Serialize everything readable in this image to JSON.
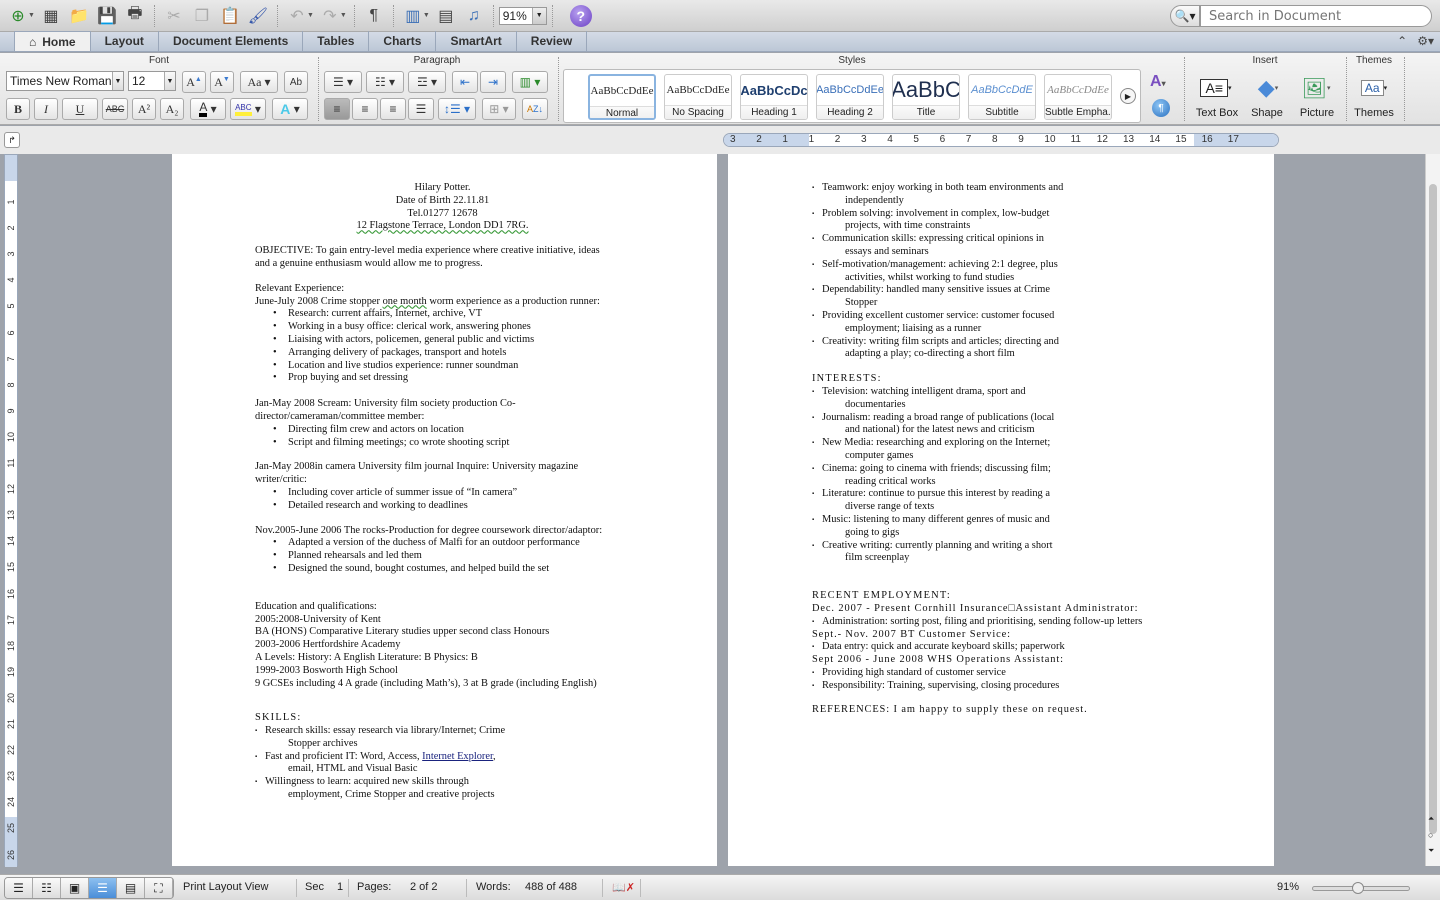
{
  "toolbar": {
    "zoom_value": "91%",
    "icons": [
      "new-document-icon",
      "gallery-icon",
      "open-icon",
      "save-icon",
      "print-icon",
      "cut-icon",
      "copy-icon",
      "paste-icon",
      "format-painter-icon",
      "undo-icon",
      "redo-icon",
      "pilcrow-icon",
      "sidebar-icon",
      "toolbox-icon",
      "media-browser-icon",
      "help-icon"
    ]
  },
  "search": {
    "placeholder": "Search in Document"
  },
  "tabs": [
    {
      "label": "Home",
      "active": true
    },
    {
      "label": "Layout"
    },
    {
      "label": "Document Elements"
    },
    {
      "label": "Tables"
    },
    {
      "label": "Charts"
    },
    {
      "label": "SmartArt"
    },
    {
      "label": "Review"
    }
  ],
  "ribbon": {
    "groups": {
      "font": "Font",
      "paragraph": "Paragraph",
      "styles": "Styles",
      "insert": "Insert",
      "themes": "Themes"
    },
    "font_name": "Times New Roman",
    "font_size": "12",
    "styles": [
      {
        "preview": "AaBbCcDdEe",
        "label": "Normal",
        "selected": true
      },
      {
        "preview": "AaBbCcDdEe",
        "label": "No Spacing"
      },
      {
        "preview": "AaBbCcDc",
        "label": "Heading 1"
      },
      {
        "preview": "AaBbCcDdEe",
        "label": "Heading 2"
      },
      {
        "preview": "AaBbC",
        "label": "Title"
      },
      {
        "preview": "AaBbCcDdE",
        "label": "Subtitle"
      },
      {
        "preview": "AaBbCcDdEe",
        "label": "Subtle Empha..."
      }
    ],
    "insert": [
      "Text Box",
      "Shape",
      "Picture"
    ],
    "themes_label": "Themes",
    "format_buttons": {
      "bold": "B",
      "italic": "I",
      "underline": "U",
      "strike": "ABC",
      "superscript": "A²",
      "subscript": "A₂"
    }
  },
  "ruler": {
    "horizontal": [
      "3",
      "2",
      "1",
      "1",
      "2",
      "3",
      "4",
      "5",
      "6",
      "7",
      "8",
      "9",
      "10",
      "11",
      "12",
      "13",
      "14",
      "15",
      "16",
      "17"
    ],
    "vertical": [
      "1",
      "2",
      "3",
      "4",
      "5",
      "6",
      "7",
      "8",
      "9",
      "10",
      "11",
      "12",
      "13",
      "14",
      "15",
      "16",
      "17",
      "18",
      "19",
      "20",
      "21",
      "22",
      "23",
      "24",
      "25",
      "26"
    ]
  },
  "page1": {
    "header": [
      "Hilary Potter.",
      "Date of Birth 22.11.81",
      "Tel.01277 12678",
      "12 Flagstone Terrace, London DD1 7RG."
    ],
    "objective": [
      "OBJECTIVE: To gain entry-level media experience where creative initiative, ideas",
      "and a genuine enthusiasm would allow me to progress."
    ],
    "relevant_heading": "Relevant Experience:",
    "job1": {
      "title_pre": "June-July 2008 Crime stopper ",
      "title_mid": "one month",
      "title_post": " worm experience as a production runner:",
      "bullets": [
        "Research: current affairs, Internet, archive, VT",
        "Working in a busy office: clerical work, answering phones",
        "Liaising with actors, policemen, general public and victims",
        "Arranging delivery of packages, transport and hotels",
        "Location and live studios experience: runner soundman",
        "Prop buying and set dressing"
      ]
    },
    "job2": {
      "title": [
        "Jan-May 2008 Scream: University film society production Co-",
        "director/cameraman/committee member:"
      ],
      "bullets": [
        "Directing film crew and actors on location",
        "Script and filming meetings; co wrote shooting script"
      ]
    },
    "job3": {
      "title": [
        "Jan-May 2008in camera University film journal Inquire: University magazine",
        "writer/critic:"
      ],
      "bullets": [
        "Including cover article of summer issue of “In camera”",
        "Detailed research and working to deadlines"
      ]
    },
    "job4": {
      "title": "Nov.2005-June 2006 The rocks-Production for degree coursework director/adaptor:",
      "bullets": [
        "Adapted a version of the duchess of Malfi for an outdoor performance",
        "Planned rehearsals and led them",
        "Designed the sound, bought costumes, and helped build the set"
      ]
    },
    "education": [
      "Education and qualifications:",
      "2005:2008-University of Kent",
      "BA (HONS) Comparative Literary studies upper second class Honours",
      "2003-2006 Hertfordshire Academy",
      "A Levels: History: A English Literature: B Physics: B",
      "1999-2003 Bosworth High School",
      "9 GCSEs including 4 A grade (including Math’s), 3 at B grade (including English)"
    ],
    "skills_heading": "SKILLS:",
    "skills": [
      {
        "line1": "Research skills: essay research via library/Internet; Crime",
        "line2": "Stopper archives"
      },
      {
        "line1_pre": "Fast and proficient IT: Word, Access, ",
        "link": "Internet Explorer",
        "line1_post": ",",
        "line2": "email, HTML and Visual Basic"
      },
      {
        "line1": "Willingness to learn: acquired new skills through",
        "line2": "employment, Crime Stopper and creative projects"
      }
    ]
  },
  "page2": {
    "skills": [
      {
        "line1": "Teamwork: enjoy working in both team environments and",
        "line2": "independently"
      },
      {
        "line1": "Problem solving: involvement in complex, low-budget",
        "line2": "projects, with time constraints"
      },
      {
        "line1": "Communication skills: expressing critical opinions in",
        "line2": "essays and seminars"
      },
      {
        "line1": "Self-motivation/management: achieving 2:1 degree, plus",
        "line2": "activities, whilst working to fund studies"
      },
      {
        "line1": "Dependability: handled many sensitive issues at Crime",
        "line2": "Stopper"
      },
      {
        "line1": "Providing excellent customer service: customer focused",
        "line2": "employment; liaising as a runner"
      },
      {
        "line1": "Creativity: writing film scripts and articles; directing and",
        "line2": "adapting a play; co-directing a short film"
      }
    ],
    "interests_heading": "INTERESTS:",
    "interests": [
      {
        "line1": "Television: watching intelligent drama, sport and",
        "line2": "documentaries"
      },
      {
        "line1": "Journalism: reading a broad range of publications (local",
        "line2": "and national) for the latest news and criticism"
      },
      {
        "line1": "New Media: researching and exploring on the Internet;",
        "line2": "computer games"
      },
      {
        "line1": "Cinema: going to cinema with friends; discussing film;",
        "line2": "reading critical works"
      },
      {
        "line1": "Literature: continue to pursue this interest by reading a",
        "line2": "diverse range of texts"
      },
      {
        "line1": "Music: listening to many different genres of music and",
        "line2": "going to gigs"
      },
      {
        "line1": "Creative writing: currently planning and writing a short",
        "line2": "film screenplay"
      }
    ],
    "employment_heading": "RECENT EMPLOYMENT:",
    "emp1_title": "Dec. 2007 - Present Cornhill Insurance□Assistant Administrator:",
    "emp1_bullet": "Administration: sorting post, filing and prioritising, sending follow-up letters",
    "emp2_title": "Sept.- Nov. 2007 BT Customer Service:",
    "emp2_bullet": "Data entry: quick and accurate keyboard skills; paperwork",
    "emp3_title": "Sept 2006 - June 2008 WHS Operations Assistant:",
    "emp3_bullets": [
      "Providing high standard of customer service",
      "Responsibility: Training, supervising, closing procedures"
    ],
    "references": "REFERENCES: I am happy to supply these on request."
  },
  "status": {
    "view": "Print Layout View",
    "sec_label": "Sec",
    "sec_value": "1",
    "pages_label": "Pages:",
    "pages_value": "2 of 2",
    "words_label": "Words:",
    "words_value": "488 of 488",
    "zoom": "91%",
    "zoom_fraction": 0.45
  }
}
